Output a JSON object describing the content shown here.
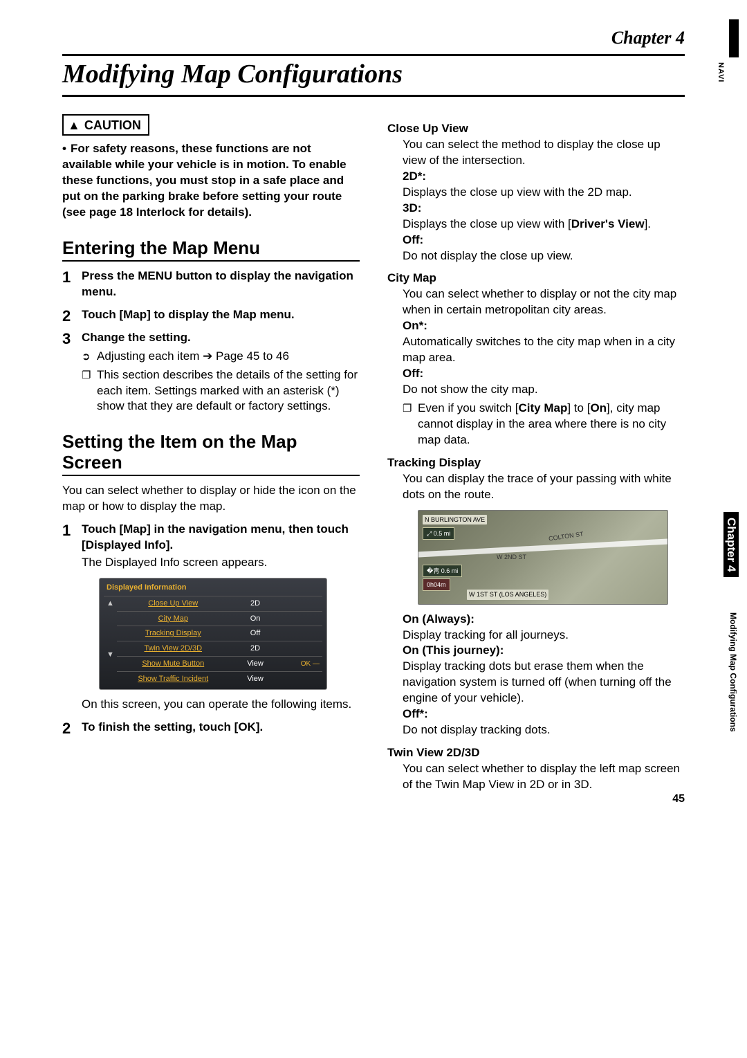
{
  "chapter": "Chapter 4",
  "title": "Modifying Map Configurations",
  "side": {
    "navi": "NAVI",
    "chapter": "Chapter 4",
    "subtitle": "Modifying Map Configurations"
  },
  "caution": {
    "label": "CAUTION",
    "text": "For safety reasons, these functions are not available while your vehicle is in motion. To enable these functions, you must stop in a safe place and put on the parking brake before setting your route (see page 18 Interlock for details)."
  },
  "sections": {
    "entering": {
      "heading": "Entering the Map Menu",
      "step1": "Press the MENU button to display the navigation menu.",
      "step2": "Touch [Map] to display the Map menu.",
      "step3": "Change the setting.",
      "step3_sub1": "Adjusting each item ➔ Page 45 to 46",
      "step3_sub2": "This section describes the details of the setting for each item. Settings marked with an asterisk (*) show that they are default or factory settings."
    },
    "setting": {
      "heading": "Setting the Item on the Map Screen",
      "intro": "You can select whether to display or hide the icon on the map or how to display the map.",
      "step1_title": "Touch [Map] in the navigation menu, then touch [Displayed Info].",
      "step1_body": "The Displayed Info screen appears.",
      "after_shot": "On this screen, you can operate the following items.",
      "step2": "To finish the setting, touch [OK]."
    }
  },
  "screenshot": {
    "title": "Displayed Information",
    "rows": [
      {
        "label": "Close Up View",
        "value": "2D"
      },
      {
        "label": "City Map",
        "value": "On"
      },
      {
        "label": "Tracking Display",
        "value": "Off"
      },
      {
        "label": "Twin View 2D/3D",
        "value": "2D"
      },
      {
        "label": "Show Mute Button",
        "value": "View"
      },
      {
        "label": "Show Traffic Incident",
        "value": "View"
      }
    ],
    "ok": "OK"
  },
  "right": {
    "closeup": {
      "heading": "Close Up View",
      "intro": "You can select the method to display the close up view of the intersection.",
      "opt2d": "2D*:",
      "opt2d_body": "Displays the close up view with the 2D map.",
      "opt3d": "3D:",
      "opt3d_body_a": "Displays the close up view with [",
      "opt3d_body_bold": "Driver's View",
      "opt3d_body_b": "].",
      "optoff": "Off:",
      "optoff_body": "Do not display the close up view."
    },
    "citymap": {
      "heading": "City Map",
      "intro": "You can select whether to display or not the city map when in certain metropolitan city areas.",
      "on": "On*:",
      "on_body": "Automatically switches to the city map when in a city map area.",
      "off": "Off:",
      "off_body": "Do not show the city map.",
      "note_a": "Even if you switch [",
      "note_b1": "City Map",
      "note_c": "] to [",
      "note_b2": "On",
      "note_d": "], city map cannot display in the area where there is no city map data."
    },
    "tracking": {
      "heading": "Tracking Display",
      "intro": "You can display the trace of your passing with white dots on the route.",
      "on_always": "On (Always):",
      "on_always_body": "Display tracking for all journeys.",
      "on_journey": "On (This journey):",
      "on_journey_body": "Display tracking dots but erase them when the navigation system is turned off (when turning off the engine of your vehicle).",
      "off": "Off*:",
      "off_body": "Do not display tracking dots."
    },
    "twin": {
      "heading": "Twin View 2D/3D",
      "intro": "You can select whether to display the left map screen of the Twin Map View in 2D or in 3D."
    }
  },
  "map_labels": {
    "top_street": "N BURLINGTON AVE",
    "scale": "0.5 mi",
    "dist": "0.6 mi",
    "time": "0h04m",
    "mid_street": "W 2ND ST",
    "side_street": "COLTON ST",
    "bottom": "W 1ST ST (LOS ANGELES)"
  },
  "page_number": "45"
}
